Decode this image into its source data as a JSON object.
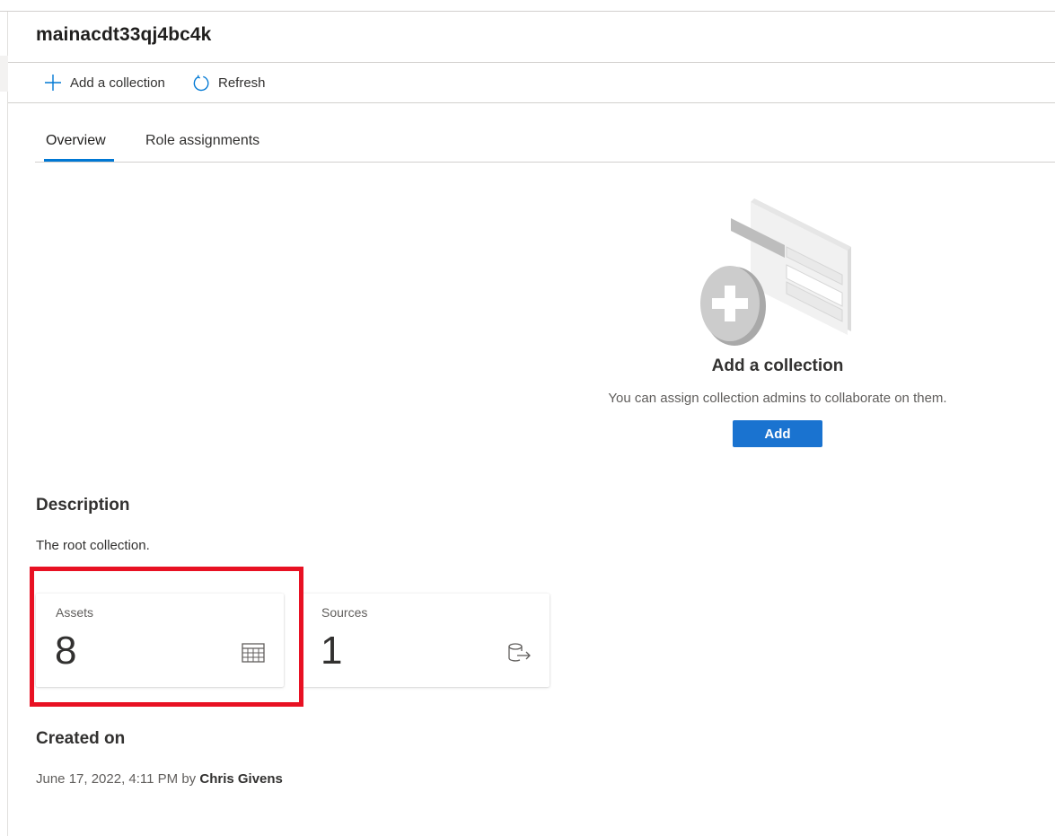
{
  "collection": {
    "name": "mainacdt33qj4bc4k"
  },
  "command_bar": {
    "add_label": "Add a collection",
    "add_icon": "plus-icon",
    "refresh_label": "Refresh",
    "refresh_icon": "refresh-icon",
    "accent": "#0078d4"
  },
  "tabs": [
    {
      "label": "Overview",
      "selected": true
    },
    {
      "label": "Role assignments",
      "selected": false
    }
  ],
  "empty_state": {
    "title": "Add a collection",
    "subtitle": "You can assign collection admins to collaborate on them.",
    "button_label": "Add",
    "illustration_icon": "add-collection-illustration"
  },
  "description": {
    "heading": "Description",
    "text": "The root collection."
  },
  "cards": [
    {
      "label": "Assets",
      "value": "8",
      "icon": "table-grid-icon",
      "highlighted": true
    },
    {
      "label": "Sources",
      "value": "1",
      "icon": "database-export-icon",
      "highlighted": false
    }
  ],
  "created": {
    "heading": "Created on",
    "date": "June 17, 2022, 4:11 PM",
    "by_label": "by",
    "author": "Chris Givens"
  },
  "colors": {
    "primary_button": "#1a73d0",
    "highlight_box": "#e81123",
    "tab_underline": "#0078d4"
  }
}
